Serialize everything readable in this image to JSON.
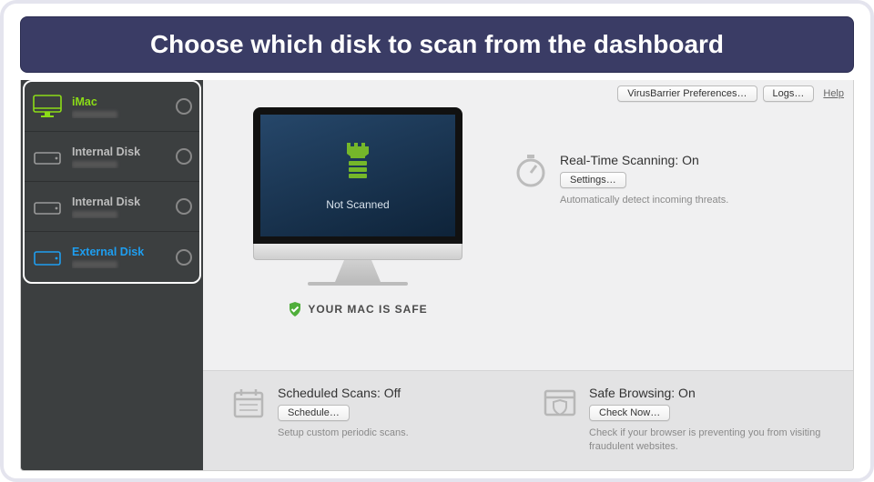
{
  "banner": "Choose which disk to scan from the dashboard",
  "sidebar": {
    "items": [
      {
        "label": "iMac"
      },
      {
        "label": "Internal Disk"
      },
      {
        "label": "Internal Disk"
      },
      {
        "label": "External Disk"
      }
    ]
  },
  "topbar": {
    "prefs": "VirusBarrier Preferences…",
    "logs": "Logs…",
    "help": "Help"
  },
  "monitor": {
    "status": "Not Scanned",
    "safe": "YOUR MAC IS SAFE"
  },
  "realtime": {
    "title": "Real-Time Scanning: On",
    "button": "Settings…",
    "desc": "Automatically detect incoming threats."
  },
  "scheduled": {
    "title": "Scheduled Scans: Off",
    "button": "Schedule…",
    "desc": "Setup custom periodic scans."
  },
  "safebrowsing": {
    "title": "Safe Browsing: On",
    "button": "Check Now…",
    "desc": "Check if your browser is preventing you from visiting fraudulent websites."
  }
}
